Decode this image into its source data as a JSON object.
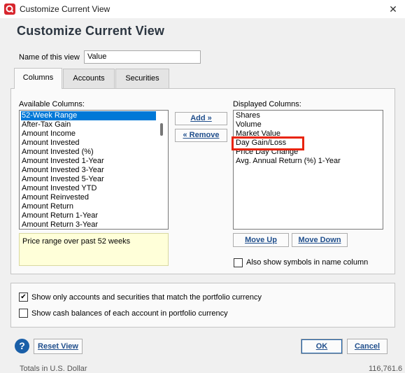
{
  "window": {
    "title": "Customize Current View",
    "close_glyph": "✕",
    "app_icon_glyph": "Q"
  },
  "dialog": {
    "heading": "Customize Current View",
    "name_label": "Name of this view",
    "name_value": "Value"
  },
  "tabs": [
    {
      "label": "Columns",
      "active": true
    },
    {
      "label": "Accounts",
      "active": false
    },
    {
      "label": "Securities",
      "active": false
    }
  ],
  "available": {
    "label": "Available Columns:",
    "items": [
      "52-Week Range",
      "After-Tax Gain",
      "Amount Income",
      "Amount Invested",
      "Amount Invested (%)",
      "Amount Invested 1-Year",
      "Amount Invested 3-Year",
      "Amount Invested 5-Year",
      "Amount Invested YTD",
      "Amount Reinvested",
      "Amount Return",
      "Amount Return 1-Year",
      "Amount Return 3-Year"
    ],
    "selected_index": 0,
    "description": "Price range over past 52 weeks"
  },
  "buttons": {
    "add": "Add »",
    "remove": "« Remove",
    "move_up": "Move Up",
    "move_down": "Move Down",
    "reset_view": "Reset View",
    "ok": "OK",
    "cancel": "Cancel"
  },
  "displayed": {
    "label": "Displayed Columns:",
    "items": [
      "Shares",
      "Volume",
      "Market Value",
      "Day Gain/Loss",
      "Price Day Change",
      "Avg. Annual Return (%) 1-Year"
    ],
    "highlighted_index": 3
  },
  "options": {
    "show_symbols": {
      "label": "Also show symbols in name column",
      "checked": false
    },
    "match_currency": {
      "label": "Show only accounts and securities that match the portfolio currency",
      "checked": true
    },
    "cash_balances": {
      "label": "Show cash balances of each account in portfolio currency",
      "checked": false
    }
  },
  "help_glyph": "?",
  "background_partial": {
    "left": "Totals in U.S. Dollar",
    "right": "116,761.6"
  },
  "colors": {
    "accent": "#1a5fa8",
    "selection": "#0078d7",
    "highlight_box": "#e8240c",
    "description_bg": "#ffffd9"
  }
}
